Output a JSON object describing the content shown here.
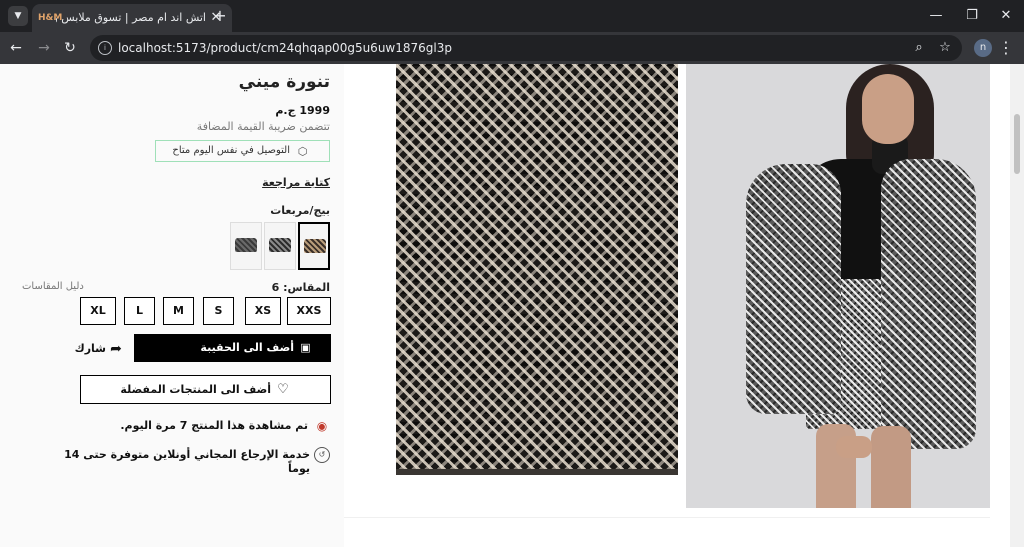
{
  "browser": {
    "tab_title": "اتش اند ام مصر | تسوق ملابس وإ",
    "tab_favicon": "H&M",
    "url": "localhost:5173/product/cm24qhqap00g5u6uw1876gl3p",
    "profile_initial": "n",
    "icons": {
      "tab_menu": "chevron-down-icon",
      "close_tab": "close-icon",
      "new_tab": "plus-icon",
      "back": "arrow-left-icon",
      "forward": "arrow-right-icon",
      "reload": "reload-icon",
      "site_info": "site-info-icon",
      "zoom": "zoom-icon",
      "bookmark": "star-icon",
      "menu": "more-vert-icon",
      "minimize": "minimize-icon",
      "restore": "restore-icon",
      "close_window": "close-icon"
    }
  },
  "product": {
    "title": "تنورة ميني",
    "price": "1999 ج.م",
    "vat_note": "تتضمن ضريبة القيمة المضافة",
    "delivery_note": "التوصيل في نفس اليوم متاح",
    "write_review": "كتابة مراجعة",
    "color_label": "بيج/مربعات",
    "size_label": "المقاس: 6",
    "size_guide": "دليل المقاسات",
    "sizes": [
      "XXS",
      "XS",
      "S",
      "M",
      "L",
      "XL"
    ],
    "add_to_bag": "أضف الى الحقيبة",
    "share": "شارك",
    "add_to_favorites": "أضف الى المنتجات المفضلة",
    "views_note": "تم مشاهدة هذا المنتج 7 مرة اليوم.",
    "returns_note": "خدمة الإرجاع المجاني أونلاين متوفرة حتى 14 يوماً"
  },
  "colors": {
    "delivery_border": "#9fe0b8",
    "eye_icon": "#c0392b",
    "primary_button": "#000000"
  }
}
